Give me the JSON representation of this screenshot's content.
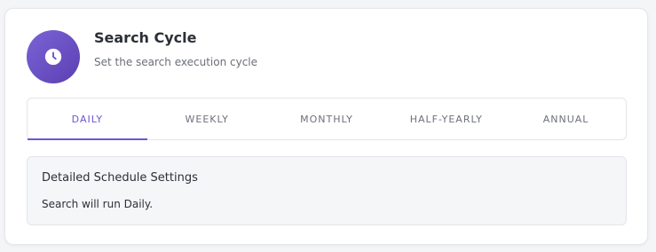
{
  "header": {
    "title": "Search Cycle",
    "subtitle": "Set the search execution cycle",
    "icon": "clock-icon",
    "accent_color": "#6f55d4"
  },
  "tabs": [
    {
      "label": "DAILY",
      "active": true
    },
    {
      "label": "WEEKLY",
      "active": false
    },
    {
      "label": "MONTHLY",
      "active": false
    },
    {
      "label": "HALF-YEARLY",
      "active": false
    },
    {
      "label": "ANNUAL",
      "active": false
    }
  ],
  "details": {
    "title": "Detailed Schedule Settings",
    "text": "Search will run Daily."
  }
}
